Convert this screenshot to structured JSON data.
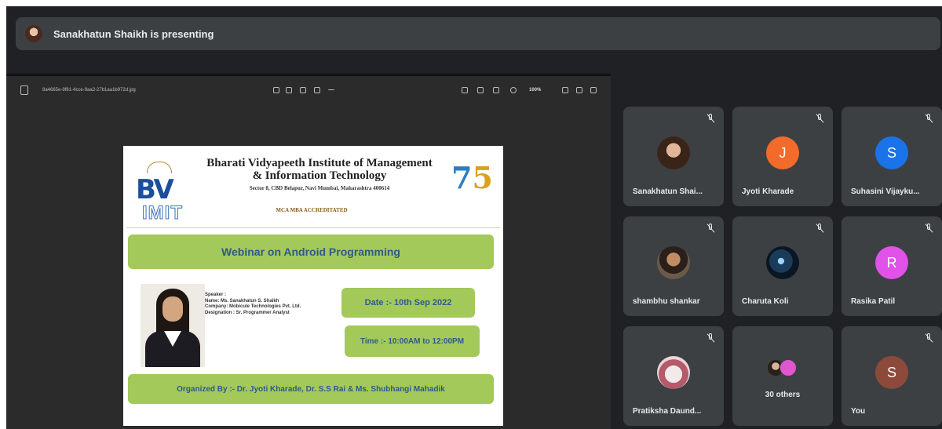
{
  "presenter": {
    "text": "Sanakhatun Shaikh is presenting"
  },
  "viewer": {
    "file_name": "8a4665e-9f81-4cce-9aa2-27b1aa1b972d.jpg",
    "zoom": "100%"
  },
  "slide": {
    "institute_name": "Bharati Vidyapeeth Institute of Management & Information Technology",
    "address": "Sector 8, CBD Belapur, Navi Mumbai, Maharashtra 400614",
    "accreditation": "MCA MBA ACCREDITATED",
    "logo_text_top": "BV",
    "logo_text_bottom": "IMIT",
    "webinar_title": "Webinar on Android Programming",
    "speaker_lines": [
      "Speaker :",
      "Name: Ms. Sanakhatun S. Shaikh",
      "Company: Mobicule Technologies Pvt. Ltd.",
      "Designation : Sr. Programmer Analyst"
    ],
    "date": "Date :- 10th Sep 2022",
    "time": "Time :- 10:00AM to 12:00PM",
    "organizers": "Organized By :- Dr. Jyoti Kharade, Dr. S.S Rai & Ms. Shubhangi Mahadik"
  },
  "participants": [
    {
      "name": "Sanakhatun Shai...",
      "initial": "",
      "color": ""
    },
    {
      "name": "Jyoti Kharade",
      "initial": "J",
      "color": "#f26b2a"
    },
    {
      "name": "Suhasini Vijayku...",
      "initial": "S",
      "color": "#1a73e8"
    },
    {
      "name": "shambhu shankar",
      "initial": "",
      "color": ""
    },
    {
      "name": "Charuta Koli",
      "initial": "",
      "color": ""
    },
    {
      "name": "Rasika Patil",
      "initial": "R",
      "color": "#e052e8"
    },
    {
      "name": "Pratiksha Daund...",
      "initial": "",
      "color": ""
    },
    {
      "name": "30 others",
      "initial": "",
      "color": ""
    },
    {
      "name": "You",
      "initial": "S",
      "color": "#8d4a3a"
    }
  ]
}
